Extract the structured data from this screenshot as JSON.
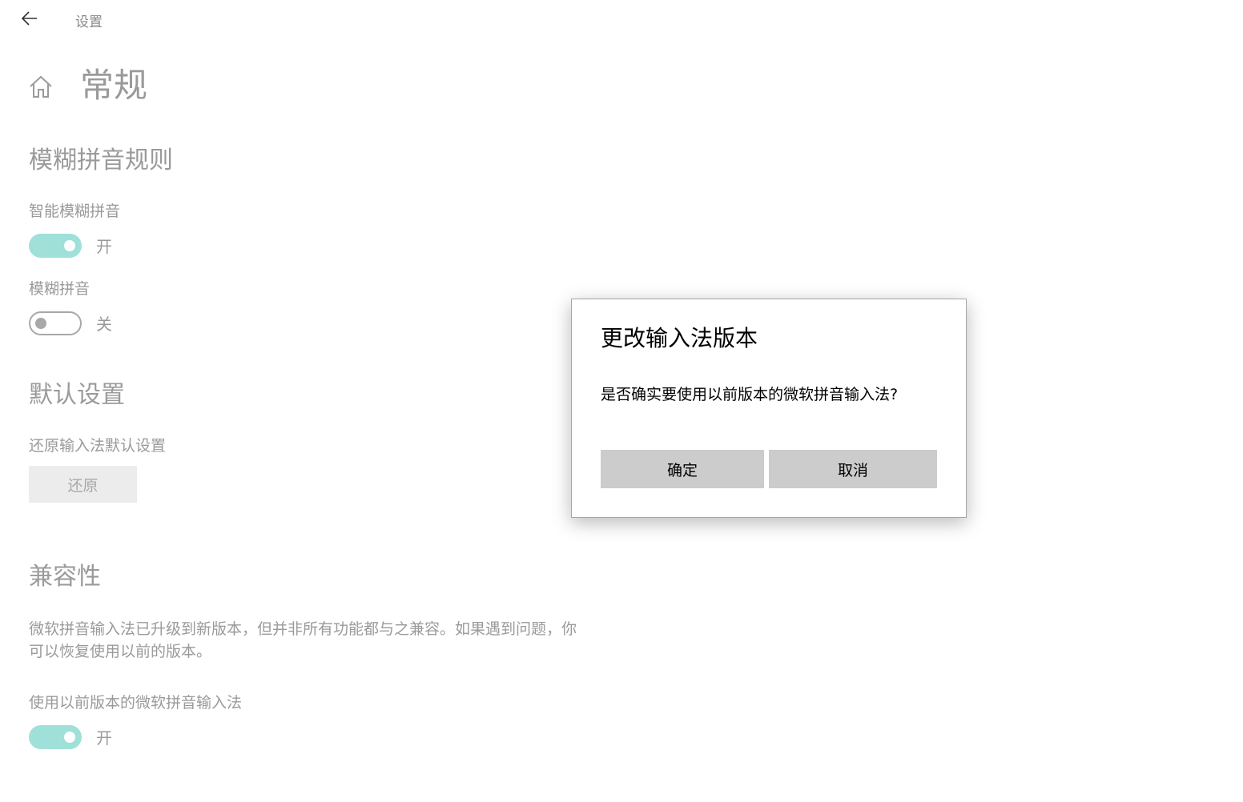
{
  "window": {
    "title": "设置",
    "back_icon": "arrow-left-icon"
  },
  "header": {
    "home_icon": "home-icon",
    "title": "常规"
  },
  "fuzzy_section": {
    "heading": "模糊拼音规则",
    "smart_fuzzy": {
      "label": "智能模糊拼音",
      "state": "开",
      "on": true
    },
    "fuzzy": {
      "label": "模糊拼音",
      "state": "关",
      "on": false
    }
  },
  "defaults_section": {
    "heading": "默认设置",
    "label": "还原输入法默认设置",
    "reset_button": "还原"
  },
  "compat_section": {
    "heading": "兼容性",
    "description": "微软拼音输入法已升级到新版本，但并非所有功能都与之兼容。如果遇到问题，你可以恢复使用以前的版本。",
    "legacy": {
      "label": "使用以前版本的微软拼音输入法",
      "state": "开",
      "on": true
    }
  },
  "dialog": {
    "title": "更改输入法版本",
    "message": "是否确实要使用以前版本的微软拼音输入法?",
    "ok_label": "确定",
    "cancel_label": "取消"
  },
  "colors": {
    "toggle_on": "#9fe0d8",
    "toggle_off_border": "#a8a8a8",
    "dialog_button": "#cccccc",
    "muted_text": "#9a9a9a"
  }
}
